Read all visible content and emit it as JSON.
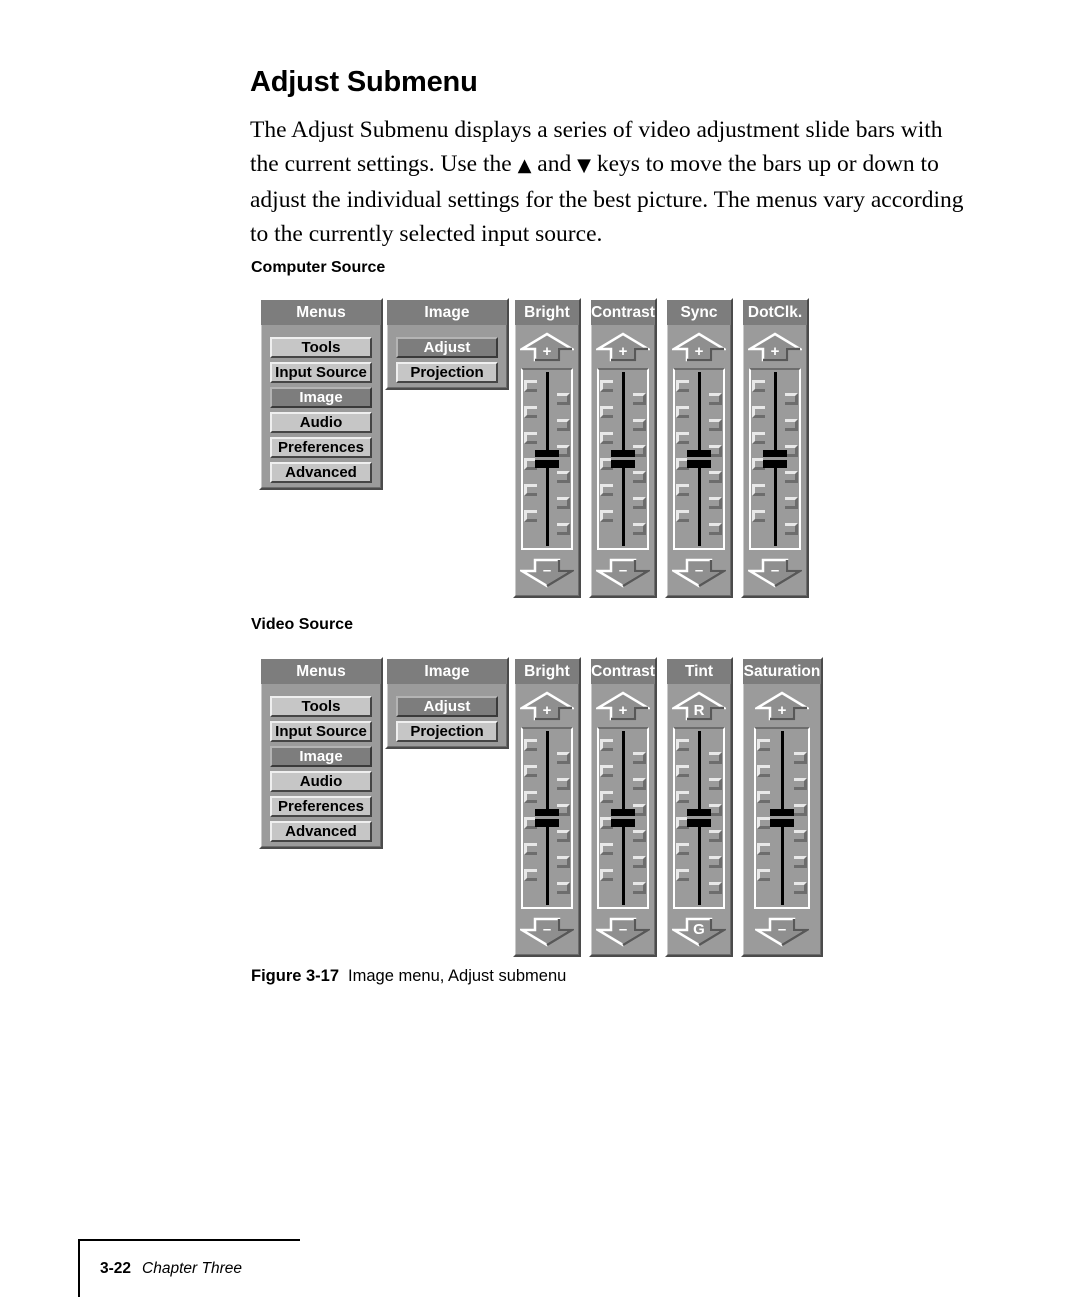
{
  "page": {
    "title": "Adjust Submenu",
    "body_text_1": "The Adjust Submenu displays a series of video adjustment slide bars with the current settings. Use the ",
    "tri_up": "▲",
    "body_text_2": " and ",
    "tri_down": "▼",
    "body_text_3": " keys to move the bars up or down to adjust the individual settings for the best picture. The menus vary according to the currently selected input source."
  },
  "sections": {
    "computer_label": "Computer Source",
    "video_label": "Video Source"
  },
  "figure": {
    "number": "Figure 3-17",
    "caption": "Image menu, Adjust submenu"
  },
  "footer": {
    "page_number": "3-22",
    "chapter": "Chapter Three"
  },
  "menus_panel": {
    "title": "Menus",
    "items": [
      {
        "label": "Tools",
        "selected": false
      },
      {
        "label": "Input Source",
        "selected": false
      },
      {
        "label": "Image",
        "selected": true
      },
      {
        "label": "Audio",
        "selected": false
      },
      {
        "label": "Preferences",
        "selected": false
      },
      {
        "label": "Advanced",
        "selected": false
      }
    ]
  },
  "image_panel": {
    "title": "Image",
    "items": [
      {
        "label": "Adjust",
        "selected": true
      },
      {
        "label": "Projection",
        "selected": false
      }
    ]
  },
  "computer_sliders": [
    {
      "title": "Bright",
      "up_glyph": "+",
      "down_glyph": "–",
      "value_pct": 50
    },
    {
      "title": "Contrast",
      "up_glyph": "+",
      "down_glyph": "–",
      "value_pct": 50
    },
    {
      "title": "Sync",
      "up_glyph": "+",
      "down_glyph": "–",
      "value_pct": 50
    },
    {
      "title": "DotClk.",
      "up_glyph": "+",
      "down_glyph": "–",
      "value_pct": 50
    }
  ],
  "video_sliders": [
    {
      "title": "Bright",
      "up_glyph": "+",
      "down_glyph": "–",
      "value_pct": 50
    },
    {
      "title": "Contrast",
      "up_glyph": "+",
      "down_glyph": "–",
      "value_pct": 50
    },
    {
      "title": "Tint",
      "up_glyph": "R",
      "down_glyph": "G",
      "value_pct": 50
    },
    {
      "title": "Saturation",
      "up_glyph": "+",
      "down_glyph": "–",
      "value_pct": 50
    }
  ],
  "colors": {
    "panel_face": "#9b9b9b",
    "title_bar": "#7d7d7d",
    "button_face": "#c6c6c6",
    "selected_face": "#7d7d7d",
    "highlight": "#ffffff",
    "shadow": "#4b4b4b",
    "track_line": "#000000"
  }
}
